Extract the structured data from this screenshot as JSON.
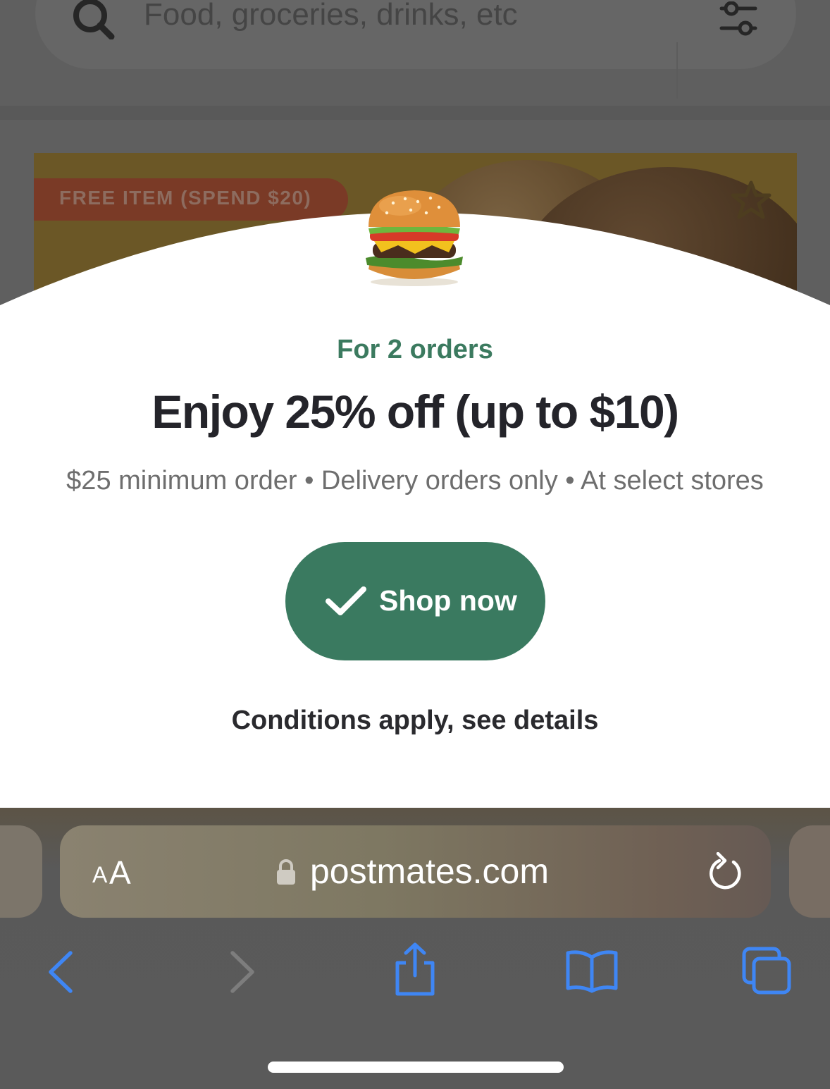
{
  "search": {
    "placeholder": "Food, groceries, drinks, etc",
    "icon": "search-icon",
    "filter_icon": "filter-icon"
  },
  "hero": {
    "promo_badge": "FREE ITEM (SPEND $20)",
    "favorite_icon": "star-icon"
  },
  "offer_sheet": {
    "image": "burger-illustration",
    "subtitle": "For 2 orders",
    "title": "Enjoy 25% off (up to $10)",
    "terms": "$25 minimum order • Delivery orders only • At select stores",
    "cta_label": "Shop now",
    "cta_icon": "checkmark-icon",
    "details_link": "Conditions apply, see details"
  },
  "browser": {
    "text_size_small": "A",
    "text_size_large": "A",
    "url": "postmates.com",
    "lock_icon": "lock-icon",
    "reload_icon": "reload-icon",
    "toolbar": [
      "back-icon",
      "forward-icon",
      "share-icon",
      "bookmarks-icon",
      "tabs-icon"
    ]
  },
  "colors": {
    "accent_green": "#3a7a60",
    "subtitle_green": "#3b7a5f",
    "ios_blue": "#3f86f4",
    "disabled_gray": "#7d7d7d"
  }
}
